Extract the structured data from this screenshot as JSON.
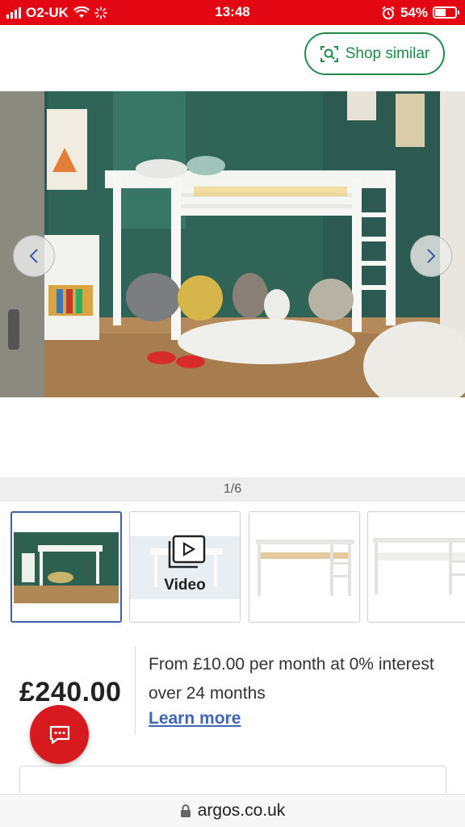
{
  "status_bar": {
    "carrier": "O2-UK",
    "time": "13:48",
    "battery": "54%",
    "icons": [
      "signal-icon",
      "wifi-icon",
      "activity-icon",
      "alarm-icon",
      "battery-icon"
    ]
  },
  "header": {
    "shop_similar_label": "Shop similar",
    "shop_similar_icon": "scan-search-icon"
  },
  "gallery": {
    "counter": "1/6",
    "prev_icon": "chevron-left-icon",
    "next_icon": "chevron-right-icon",
    "thumbnails": [
      {
        "type": "image",
        "selected": true
      },
      {
        "type": "video",
        "label": "Video"
      },
      {
        "type": "image",
        "selected": false
      },
      {
        "type": "image",
        "selected": false
      }
    ]
  },
  "pricing": {
    "price": "£240.00",
    "finance_text": "From £10.00 per month at 0% interest over 24 months",
    "learn_more": "Learn more"
  },
  "browser": {
    "url": "argos.co.uk"
  },
  "colors": {
    "brand_red": "#e30613",
    "accent_green": "#1f8a4c",
    "link_blue": "#3f66b3",
    "selected_border": "#3f5fa6",
    "chat_red": "#d71920"
  }
}
